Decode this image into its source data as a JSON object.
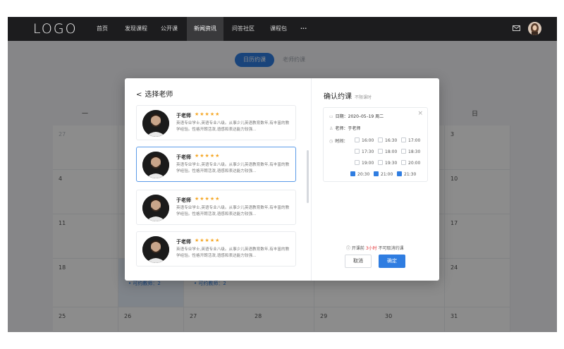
{
  "nav": {
    "logo": "LOGO",
    "items": [
      "首页",
      "发现课程",
      "公开课",
      "新闻资讯",
      "问答社区",
      "课程包",
      "···"
    ]
  },
  "toggle": {
    "calendar": "日历约课",
    "teacher": "老师约课"
  },
  "calendar": {
    "head_left": "一",
    "head_right": "日",
    "rows": [
      [
        "27",
        "",
        "",
        "",
        "",
        "",
        "3"
      ],
      [
        "4",
        "",
        "",
        "",
        "",
        "",
        "10"
      ],
      [
        "11",
        "",
        "",
        "",
        "",
        "",
        "17"
      ],
      [
        "18",
        "",
        "",
        "",
        "",
        "",
        "24"
      ],
      [
        "25",
        "26",
        "27",
        "28",
        "29",
        "30",
        "31"
      ]
    ],
    "available_label": "• 可约教师：2"
  },
  "modal": {
    "left_title": "选择老师",
    "teachers": [
      {
        "name": "于老师",
        "stars": "★★★★★",
        "desc": "英语专业学士,英语专业八级。从事少儿英语教育数年,有丰富的教学经验。性格开朗活泼,语感和表达能力较强..."
      },
      {
        "name": "于老师",
        "stars": "★★★★★",
        "desc": "英语专业学士,英语专业八级。从事少儿英语教育数年,有丰富的教学经验。性格开朗活泼,语感和表达能力较强..."
      },
      {
        "name": "于老师",
        "stars": "★★★★★",
        "desc": "英语专业学士,英语专业八级。从事少儿英语教育数年,有丰富的教学经验。性格开朗活泼,语感和表达能力较强..."
      },
      {
        "name": "于老师",
        "stars": "★★★★★",
        "desc": "英语专业学士,英语专业八级。从事少儿英语教育数年,有丰富的教学经验。性格开朗活泼,语感和表达能力较强..."
      }
    ],
    "right_title": "确认约课",
    "right_sub": "不限课时",
    "date": "日期：2020–05–19 周二",
    "teacher": "老师：于老师",
    "time_label": "时间：",
    "slots": [
      "16:00",
      "16:30",
      "17:00",
      "17:30",
      "18:00",
      "18:30",
      "19:00",
      "19:30",
      "20:00",
      "20:30",
      "21:00",
      "21:30"
    ],
    "checked": [
      "20:30",
      "21:00",
      "21:30"
    ],
    "note_pre": "开课前",
    "note_red": "3小时",
    "note_post": "不可取消约课",
    "cancel": "取消",
    "confirm": "确定"
  }
}
